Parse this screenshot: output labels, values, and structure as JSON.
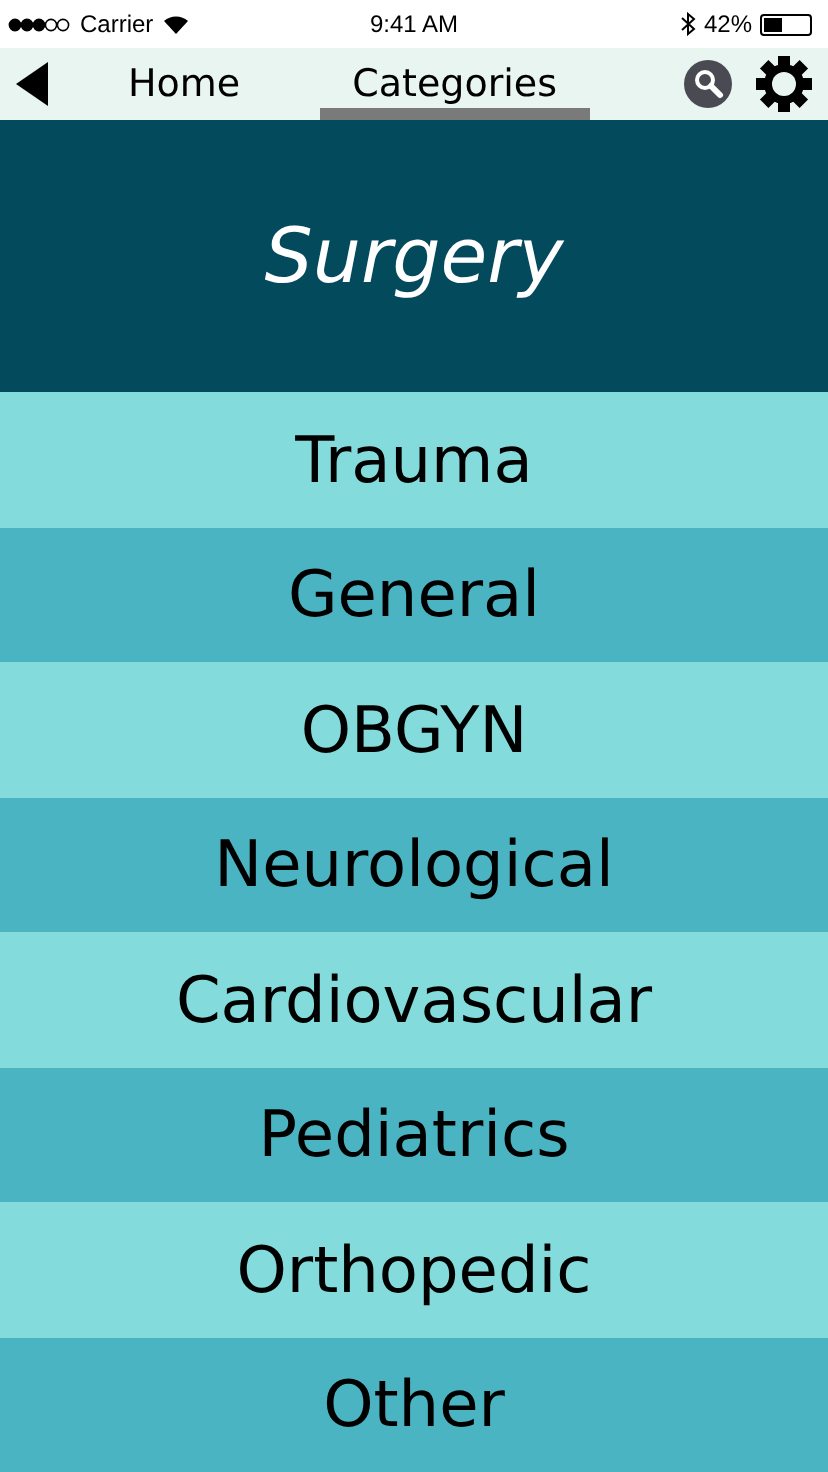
{
  "status_bar": {
    "carrier": "Carrier",
    "time": "9:41 AM",
    "battery": "42%"
  },
  "nav": {
    "tabs": [
      {
        "label": "Home",
        "selected": false
      },
      {
        "label": "Categories",
        "selected": true
      }
    ]
  },
  "header": {
    "title": "Surgery"
  },
  "categories": [
    "Trauma",
    "General",
    "OBGYN",
    "Neurological",
    "Cardiovascular",
    "Pediatrics",
    "Orthopedic",
    "Other"
  ]
}
